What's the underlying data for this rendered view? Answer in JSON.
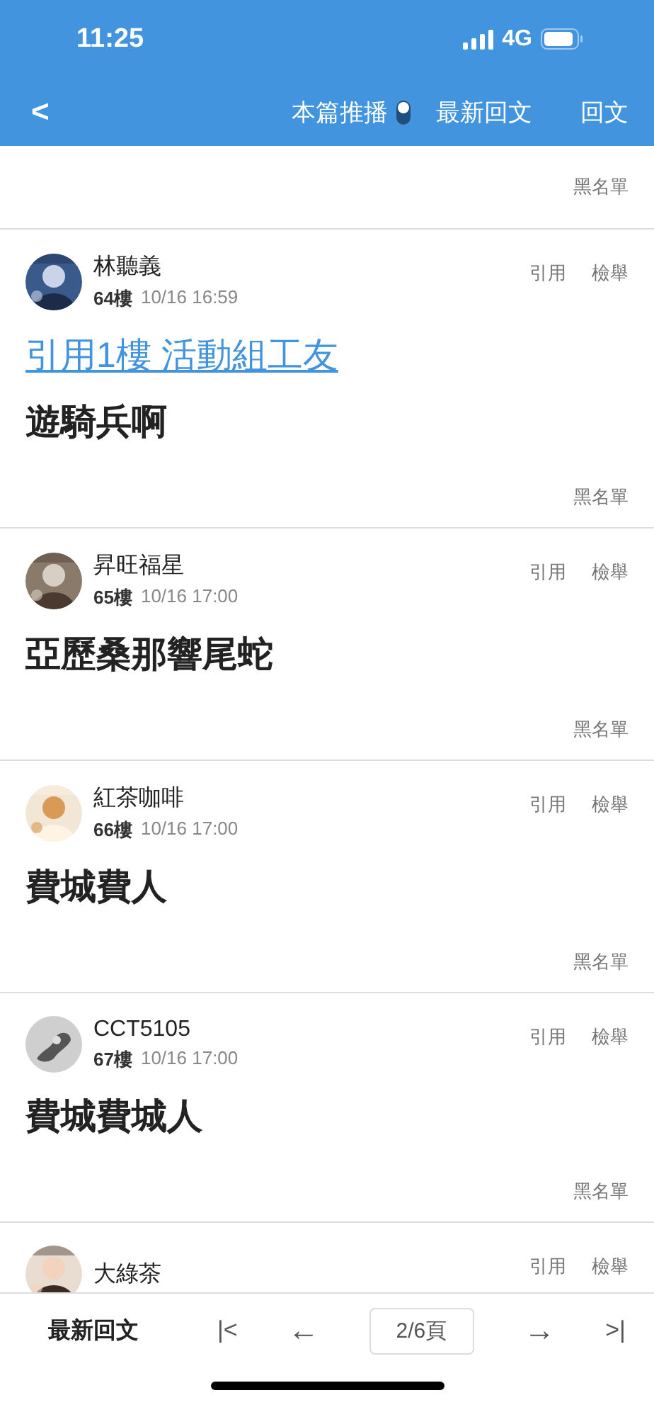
{
  "status_bar": {
    "time": "11:25",
    "network": "4G"
  },
  "nav": {
    "back": "<",
    "push": {
      "label": "本篇推播",
      "on": true
    },
    "latest": "最新回文",
    "reply": "回文"
  },
  "previous_post": {
    "blacklist": "黑名單"
  },
  "posts": [
    {
      "name": "林聽義",
      "floor": "64樓",
      "time": "10/16 16:59",
      "quote": "引用",
      "report": "檢舉",
      "quote_link": "引用1樓 活動組工友",
      "body": "遊騎兵啊",
      "blacklist": "黑名單"
    },
    {
      "name": "昇旺福星",
      "floor": "65樓",
      "time": "10/16 17:00",
      "quote": "引用",
      "report": "檢舉",
      "body": "亞歷桑那響尾蛇",
      "blacklist": "黑名單"
    },
    {
      "name": "紅茶咖啡",
      "floor": "66樓",
      "time": "10/16 17:00",
      "quote": "引用",
      "report": "檢舉",
      "body": "費城費人",
      "blacklist": "黑名單"
    },
    {
      "avatar": {
        "kind": "default"
      },
      "name": "CCT5105",
      "floor": "67樓",
      "time": "10/16 17:00",
      "quote": "引用",
      "report": "檢舉",
      "body": "費城費城人",
      "blacklist": "黑名單"
    },
    {
      "name": "大綠茶",
      "quote": "引用",
      "report": "檢舉"
    }
  ],
  "bottom_bar": {
    "latest": "最新回文",
    "first": "|<",
    "prev": "←",
    "page": "2/6頁",
    "next": "→",
    "last": ">|"
  }
}
